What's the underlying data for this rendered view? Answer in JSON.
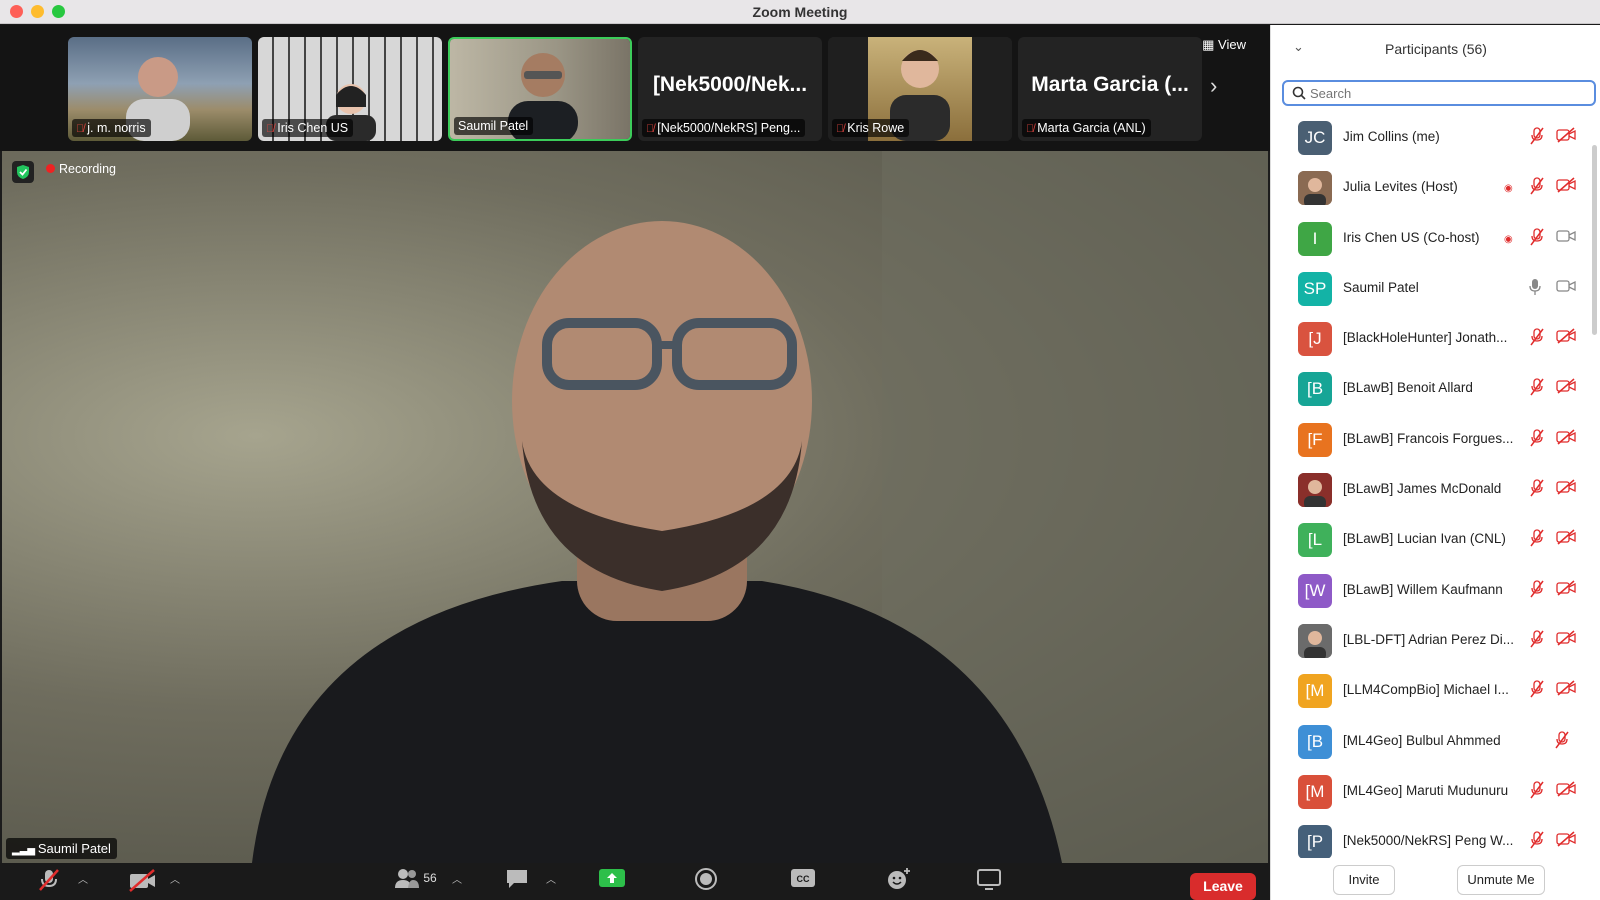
{
  "window": {
    "title": "Zoom Meeting"
  },
  "recording": {
    "label": "Recording"
  },
  "strip": {
    "view_label": "View",
    "tiles": [
      {
        "label": "j. m. norris",
        "muted": true
      },
      {
        "label": "Iris Chen US",
        "muted": true
      },
      {
        "label": "Saumil Patel",
        "muted": false,
        "active": true
      },
      {
        "label": "[Nek5000/NekRS] Peng...",
        "big_text": "[Nek5000/Nek...",
        "muted": true
      },
      {
        "label": "Kris Rowe",
        "muted": true
      },
      {
        "label": "Marta Garcia (ANL)",
        "big_text": "Marta Garcia (...",
        "muted": true
      }
    ]
  },
  "main": {
    "speaker": "Saumil Patel"
  },
  "toolbar": {
    "participants_count": "56",
    "leave_label": "Leave"
  },
  "panel": {
    "title": "Participants (56)",
    "search_placeholder": "Search",
    "invite_label": "Invite",
    "unmute_label": "Unmute Me",
    "participants": [
      {
        "initials": "JC",
        "name": "Jim Collins (me)",
        "color": "#4a5f73",
        "recording": false,
        "mic": "muted",
        "cam": "off"
      },
      {
        "initials": "",
        "name": "Julia Levites (Host)",
        "color": "#8a6a52",
        "photo": true,
        "recording": true,
        "mic": "muted",
        "cam": "off"
      },
      {
        "initials": "I",
        "name": "Iris Chen US (Co-host)",
        "color": "#3fa645",
        "recording": true,
        "mic": "muted",
        "cam": "on"
      },
      {
        "initials": "SP",
        "name": "Saumil Patel",
        "color": "#13b3a6",
        "recording": false,
        "mic": "on",
        "cam": "on"
      },
      {
        "initials": "[J",
        "name": "[BlackHoleHunter] Jonath...",
        "color": "#d9533f",
        "recording": false,
        "mic": "muted",
        "cam": "off"
      },
      {
        "initials": "[B",
        "name": "[BLawB] Benoit Allard",
        "color": "#16a596",
        "recording": false,
        "mic": "muted",
        "cam": "off"
      },
      {
        "initials": "[F",
        "name": "[BLawB] Francois Forgues...",
        "color": "#e8731f",
        "recording": false,
        "mic": "muted",
        "cam": "off"
      },
      {
        "initials": "",
        "name": "[BLawB] James McDonald",
        "color": "#8a2f2a",
        "photo": true,
        "recording": false,
        "mic": "muted",
        "cam": "off"
      },
      {
        "initials": "[L",
        "name": "[BLawB] Lucian Ivan (CNL)",
        "color": "#3fb15b",
        "recording": false,
        "mic": "muted",
        "cam": "off"
      },
      {
        "initials": "[W",
        "name": "[BLawB] Willem Kaufmann",
        "color": "#8e5ac7",
        "recording": false,
        "mic": "muted",
        "cam": "off"
      },
      {
        "initials": "",
        "name": "[LBL-DFT] Adrian Perez Di...",
        "color": "#6b6b6b",
        "photo": true,
        "recording": false,
        "mic": "muted",
        "cam": "off"
      },
      {
        "initials": "[M",
        "name": "[LLM4CompBio] Michael I...",
        "color": "#f0a420",
        "recording": false,
        "mic": "muted",
        "cam": "off"
      },
      {
        "initials": "[B",
        "name": "[ML4Geo] Bulbul Ahmmed",
        "color": "#3e8fd6",
        "recording": false,
        "mic": "muted",
        "cam": "none"
      },
      {
        "initials": "[M",
        "name": "[ML4Geo] Maruti Mudunuru",
        "color": "#d9503a",
        "recording": false,
        "mic": "muted",
        "cam": "off"
      },
      {
        "initials": "[P",
        "name": "[Nek5000/NekRS] Peng W...",
        "color": "#45607a",
        "recording": false,
        "mic": "muted",
        "cam": "off"
      }
    ]
  }
}
